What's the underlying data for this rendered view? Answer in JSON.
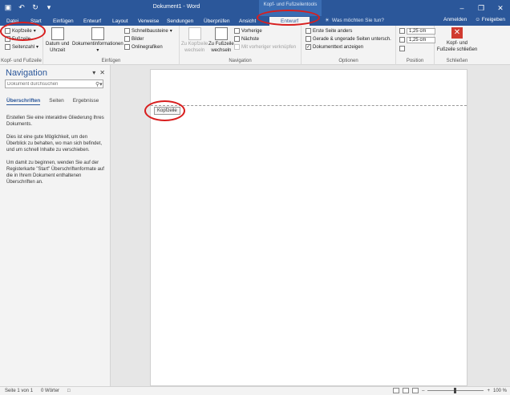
{
  "title_bar": {
    "doc_title": "Dokument1 - Word",
    "contextual_group": "Kopf- und Fußzeilentools",
    "window_controls": [
      "minimize-icon",
      "restore-icon",
      "close-icon"
    ]
  },
  "qat": {
    "icons": [
      "save-icon",
      "undo-icon",
      "redo-icon",
      "customize-qat-icon"
    ]
  },
  "tabs": [
    "Datei",
    "Start",
    "Einfügen",
    "Entwurf",
    "Layout",
    "Verweise",
    "Sendungen",
    "Überprüfen",
    "Ansicht"
  ],
  "active_tab": "Entwurf",
  "tell_me": "Was möchten Sie tun?",
  "account": {
    "signin": "Anmelden",
    "share": "Freigeben"
  },
  "ribbon": {
    "kopf_fusszeile": {
      "label": "Kopf- und Fußzeile",
      "items": [
        "Kopfzeile",
        "Fußzeile",
        "Seitenzahl"
      ]
    },
    "einfuegen": {
      "label": "Einfügen",
      "datum": [
        "Datum und",
        "Uhrzeit"
      ],
      "dokinfo": [
        "Dokumentinformationen"
      ],
      "small": [
        "Schnellbausteine",
        "Bilder",
        "Onlinegrafiken"
      ]
    },
    "navigation": {
      "label": "Navigation",
      "zu_kopfzeile": [
        "Zu Kopfzeile",
        "wechseln"
      ],
      "zu_fusszeile": [
        "Zu Fußzeile",
        "wechseln"
      ],
      "small": [
        "Vorherige",
        "Nächste",
        "Mit vorheriger verknüpfen"
      ]
    },
    "optionen": {
      "label": "Optionen",
      "items": [
        "Erste Seite anders",
        "Gerade & ungerade Seiten untersch.",
        "Dokumenttext anzeigen"
      ],
      "checked": [
        false,
        false,
        true
      ]
    },
    "position": {
      "label": "Position",
      "values": [
        "1,25 cm",
        "1,25 cm"
      ]
    },
    "schliessen": {
      "label": "Schließen",
      "button": [
        "Kopf- und",
        "Fußzeile schließen"
      ]
    }
  },
  "navigation_pane": {
    "title": "Navigation",
    "search_placeholder": "Dokument durchsuchen",
    "tabs": [
      "Überschriften",
      "Seiten",
      "Ergebnisse"
    ],
    "help": [
      "Erstellen Sie eine interaktive Gliederung Ihres Dokuments.",
      "Dies ist eine gute Möglichkeit, um den Überblick zu behalten, wo man sich befindet, und um schnell Inhalte zu verschieben.",
      "Um damit zu beginnen, wenden Sie auf der Registerkarte \"Start\" Überschriftenformate auf die in Ihrem Dokument enthaltenen Überschriften an."
    ]
  },
  "document": {
    "header_tag": "Kopfzeile"
  },
  "status_bar": {
    "page": "Seite 1 von 1",
    "words": "0 Wörter",
    "zoom": "100 %"
  },
  "colors": {
    "accent": "#2b579a",
    "annotation": "#d81e1e",
    "close_red": "#d03a2f"
  }
}
